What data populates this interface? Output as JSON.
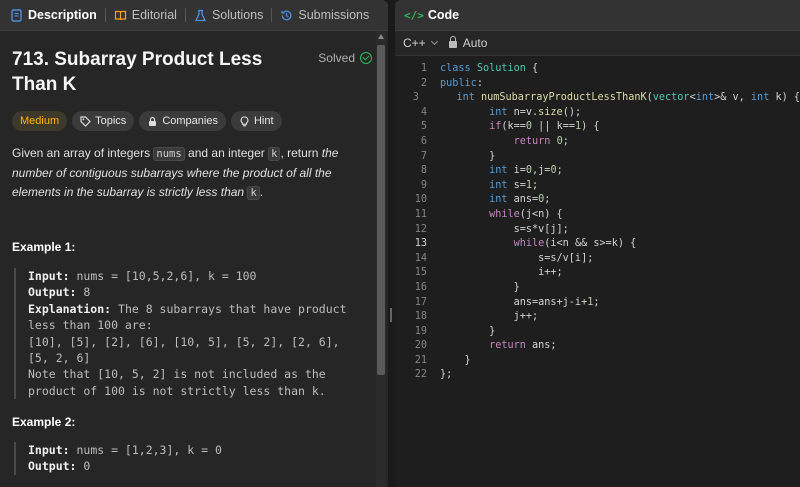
{
  "left_tabs": [
    {
      "label": "Description",
      "icon": "description-icon",
      "active": true
    },
    {
      "label": "Editorial",
      "icon": "book-icon",
      "active": false
    },
    {
      "label": "Solutions",
      "icon": "flask-icon",
      "active": false
    },
    {
      "label": "Submissions",
      "icon": "history-icon",
      "active": false
    }
  ],
  "problem": {
    "title": "713. Subarray Product Less Than K",
    "status": "Solved",
    "badges": {
      "difficulty": "Medium",
      "topics": "Topics",
      "companies": "Companies",
      "hint": "Hint"
    },
    "desc": {
      "p1": "Given an array of integers ",
      "c1": "nums",
      "p2": " and an integer ",
      "c2": "k",
      "p3": ", return ",
      "i1": "the number of contiguous subarrays where the product of all the elements in the subarray is strictly less than ",
      "c3": "k",
      "p4": "."
    },
    "examples": [
      {
        "title": "Example 1:",
        "input_label": "Input:",
        "input": " nums = [10,5,2,6], k = 100",
        "output_label": "Output:",
        "output": " 8",
        "explanation_label": "Explanation:",
        "explanation": " The 8 subarrays that have product less than 100 are:\n[10], [5], [2], [6], [10, 5], [5, 2], [2, 6], [5, 2, 6]\nNote that [10, 5, 2] is not included as the product of 100 is not strictly less than k."
      },
      {
        "title": "Example 2:",
        "input_label": "Input:",
        "input": " nums = [1,2,3], k = 0",
        "output_label": "Output:",
        "output": " 0"
      }
    ]
  },
  "editor": {
    "title": "Code",
    "language": "C++",
    "mode": "Auto",
    "current_line": 13,
    "lines": [
      [
        [
          "kw",
          "class"
        ],
        [
          "t",
          " "
        ],
        [
          "cls",
          "Solution"
        ],
        [
          "t",
          " {"
        ]
      ],
      [
        [
          "kw",
          "public"
        ],
        [
          "t",
          ":"
        ]
      ],
      [
        [
          "t",
          "    "
        ],
        [
          "ty",
          "int"
        ],
        [
          "t",
          " "
        ],
        [
          "fn",
          "numSubarrayProductLessThanK"
        ],
        [
          "t",
          "("
        ],
        [
          "cls",
          "vector"
        ],
        [
          "t",
          "<"
        ],
        [
          "ty",
          "int"
        ],
        [
          "t",
          ">& v, "
        ],
        [
          "ty",
          "int"
        ],
        [
          "t",
          " k) {"
        ]
      ],
      [
        [
          "t",
          "        "
        ],
        [
          "ty",
          "int"
        ],
        [
          "t",
          " n=v."
        ],
        [
          "fn",
          "size"
        ],
        [
          "t",
          "();"
        ]
      ],
      [
        [
          "t",
          "        "
        ],
        [
          "ctl",
          "if"
        ],
        [
          "t",
          "(k=="
        ],
        [
          "num",
          "0"
        ],
        [
          "t",
          " || k=="
        ],
        [
          "num",
          "1"
        ],
        [
          "t",
          ") {"
        ]
      ],
      [
        [
          "t",
          "            "
        ],
        [
          "ctl",
          "return"
        ],
        [
          "t",
          " "
        ],
        [
          "num",
          "0"
        ],
        [
          "t",
          ";"
        ]
      ],
      [
        [
          "t",
          "        }"
        ]
      ],
      [
        [
          "t",
          "        "
        ],
        [
          "ty",
          "int"
        ],
        [
          "t",
          " i="
        ],
        [
          "num",
          "0"
        ],
        [
          "t",
          ",j="
        ],
        [
          "num",
          "0"
        ],
        [
          "t",
          ";"
        ]
      ],
      [
        [
          "t",
          "        "
        ],
        [
          "ty",
          "int"
        ],
        [
          "t",
          " s="
        ],
        [
          "num",
          "1"
        ],
        [
          "t",
          ";"
        ]
      ],
      [
        [
          "t",
          "        "
        ],
        [
          "ty",
          "int"
        ],
        [
          "t",
          " ans="
        ],
        [
          "num",
          "0"
        ],
        [
          "t",
          ";"
        ]
      ],
      [
        [
          "t",
          "        "
        ],
        [
          "ctl",
          "while"
        ],
        [
          "t",
          "(j<n) {"
        ]
      ],
      [
        [
          "t",
          "            s=s*v[j];"
        ]
      ],
      [
        [
          "t",
          "            "
        ],
        [
          "ctl",
          "while"
        ],
        [
          "t",
          "(i<n && s>=k) {"
        ]
      ],
      [
        [
          "t",
          "                s=s/v[i];"
        ]
      ],
      [
        [
          "t",
          "                i++;"
        ]
      ],
      [
        [
          "t",
          "            }"
        ]
      ],
      [
        [
          "t",
          "            ans=ans+j-i+"
        ],
        [
          "num",
          "1"
        ],
        [
          "t",
          ";"
        ]
      ],
      [
        [
          "t",
          "            j++;"
        ]
      ],
      [
        [
          "t",
          "        }"
        ]
      ],
      [
        [
          "t",
          "        "
        ],
        [
          "ctl",
          "return"
        ],
        [
          "t",
          " ans;"
        ]
      ],
      [
        [
          "t",
          "    }"
        ]
      ],
      [
        [
          "t",
          "};"
        ]
      ]
    ]
  },
  "colors": {
    "accent_green": "#2cbb5d",
    "medium": "#ffb800",
    "link_blue": "#4a90e2"
  }
}
